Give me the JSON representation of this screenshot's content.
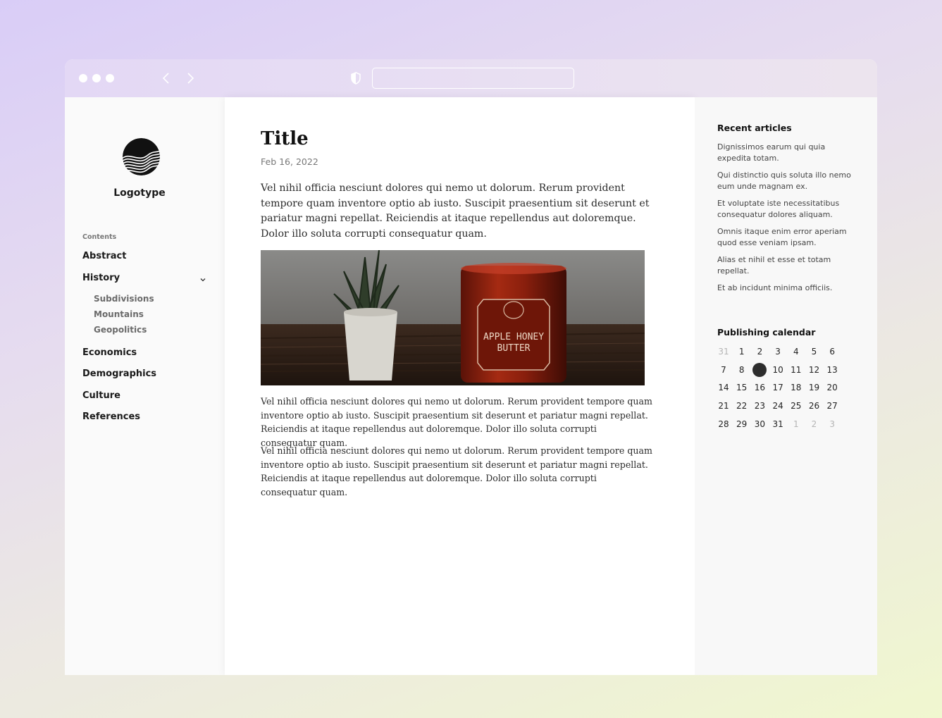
{
  "browser": {
    "url_value": ""
  },
  "sidebar": {
    "logotype": "Logotype",
    "contents_label": "Contents",
    "items": [
      {
        "label": "Abstract"
      },
      {
        "label": "History",
        "expanded": true,
        "children": [
          "Subdivisions",
          "Mountains",
          "Geopolitics"
        ]
      },
      {
        "label": "Economics"
      },
      {
        "label": "Demographics"
      },
      {
        "label": "Culture"
      },
      {
        "label": "References"
      }
    ]
  },
  "article": {
    "title": "Title",
    "date": "Feb 16, 2022",
    "lead": "Vel nihil officia nesciunt dolores qui nemo ut dolorum. Rerum provident tempore quam inventore optio ab iusto. Suscipit praesentium sit deserunt et pariatur magni repellat. Reiciendis at itaque repellendus aut doloremque. Dolor illo soluta corrupti consequatur quam.",
    "image": {
      "label_line1": "APPLE HONEY",
      "label_line2": "BUTTER"
    },
    "paragraphs": [
      "Vel nihil officia nesciunt dolores qui nemo ut dolorum. Rerum provident tempore quam inventore optio ab iusto. Suscipit praesentium sit deserunt et pariatur magni repellat. Reiciendis at itaque repellendus aut doloremque. Dolor illo soluta corrupti consequatur quam.",
      "Vel nihil officia nesciunt dolores qui nemo ut dolorum. Rerum provident tempore quam inventore optio ab iusto. Suscipit praesentium sit deserunt et pariatur magni repellat. Reiciendis at itaque repellendus aut doloremque. Dolor illo soluta corrupti consequatur quam."
    ]
  },
  "right": {
    "recent_title": "Recent articles",
    "recent": [
      "Dignissimos earum qui quia expedita totam.",
      "Qui distinctio quis soluta illo nemo eum unde magnam ex.",
      "Et voluptate iste necessitatibus consequatur dolores aliquam.",
      "Omnis itaque enim error aperiam quod esse veniam ipsam.",
      "Alias et nihil et esse et totam repellat.",
      "Et ab incidunt minima officiis."
    ],
    "calendar_title": "Publishing calendar",
    "calendar": [
      [
        "31",
        "1",
        "2",
        "3",
        "4",
        "5",
        "6"
      ],
      [
        "7",
        "8",
        "9",
        "10",
        "11",
        "12",
        "13"
      ],
      [
        "14",
        "15",
        "16",
        "17",
        "18",
        "19",
        "20"
      ],
      [
        "21",
        "22",
        "23",
        "24",
        "25",
        "26",
        "27"
      ],
      [
        "28",
        "29",
        "30",
        "31",
        "1",
        "2",
        "3"
      ]
    ],
    "calendar_muted": [
      "0-0",
      "4-4",
      "4-5",
      "4-6"
    ],
    "calendar_selected": "9"
  }
}
